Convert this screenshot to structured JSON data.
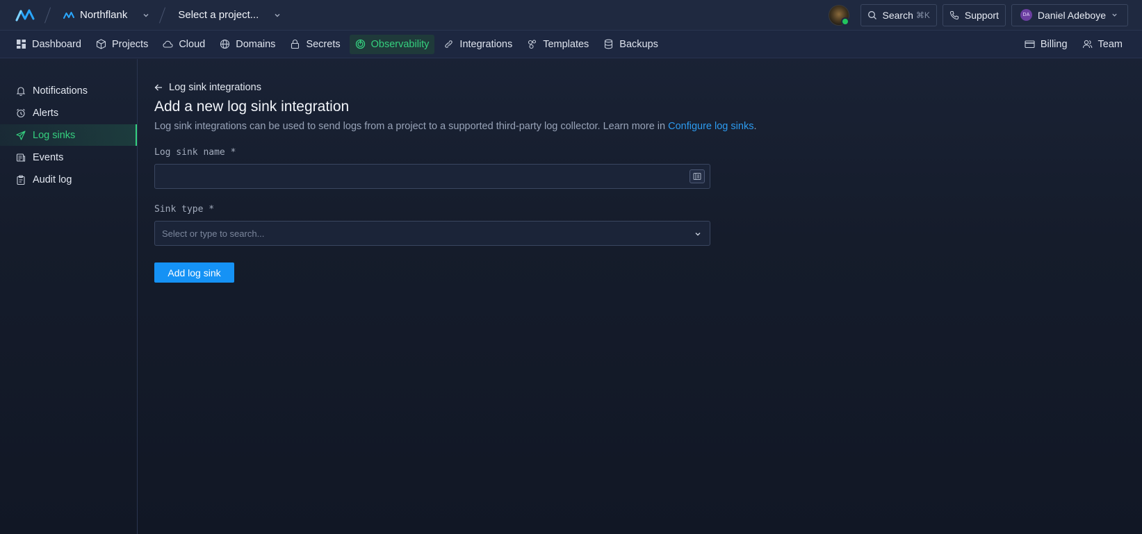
{
  "topbar": {
    "team_name": "Northflank",
    "project_select": "Select a project...",
    "search_label": "Search",
    "search_shortcut": "⌘K",
    "support_label": "Support",
    "user_initials": "DA",
    "user_name": "Daniel Adeboye"
  },
  "nav": {
    "items": [
      {
        "label": "Dashboard",
        "icon": "dashboard-icon"
      },
      {
        "label": "Projects",
        "icon": "cube-icon"
      },
      {
        "label": "Cloud",
        "icon": "cloud-icon"
      },
      {
        "label": "Domains",
        "icon": "globe-icon"
      },
      {
        "label": "Secrets",
        "icon": "lock-icon"
      },
      {
        "label": "Observability",
        "icon": "observability-icon",
        "active": true
      },
      {
        "label": "Integrations",
        "icon": "link-icon"
      },
      {
        "label": "Templates",
        "icon": "templates-icon"
      },
      {
        "label": "Backups",
        "icon": "database-icon"
      }
    ],
    "right": [
      {
        "label": "Billing",
        "icon": "credit-card-icon"
      },
      {
        "label": "Team",
        "icon": "users-icon"
      }
    ]
  },
  "sidebar": {
    "items": [
      {
        "label": "Notifications",
        "icon": "bell-icon"
      },
      {
        "label": "Alerts",
        "icon": "alarm-clock-icon"
      },
      {
        "label": "Log sinks",
        "icon": "send-icon",
        "active": true
      },
      {
        "label": "Events",
        "icon": "events-icon"
      },
      {
        "label": "Audit log",
        "icon": "clipboard-icon"
      }
    ]
  },
  "main": {
    "back_label": "Log sink integrations",
    "title": "Add a new log sink integration",
    "description": "Log sink integrations can be used to send logs from a project to a supported third-party log collector. Learn more in ",
    "link_text": "Configure log sinks",
    "description_end": ".",
    "name_label": "Log sink name *",
    "name_value": "",
    "sink_type_label": "Sink type *",
    "sink_type_placeholder": "Select or type to search...",
    "submit_label": "Add log sink"
  },
  "colors": {
    "accent_green": "#35d07f",
    "primary_blue": "#1592f5",
    "link_blue": "#2d9bf0"
  }
}
